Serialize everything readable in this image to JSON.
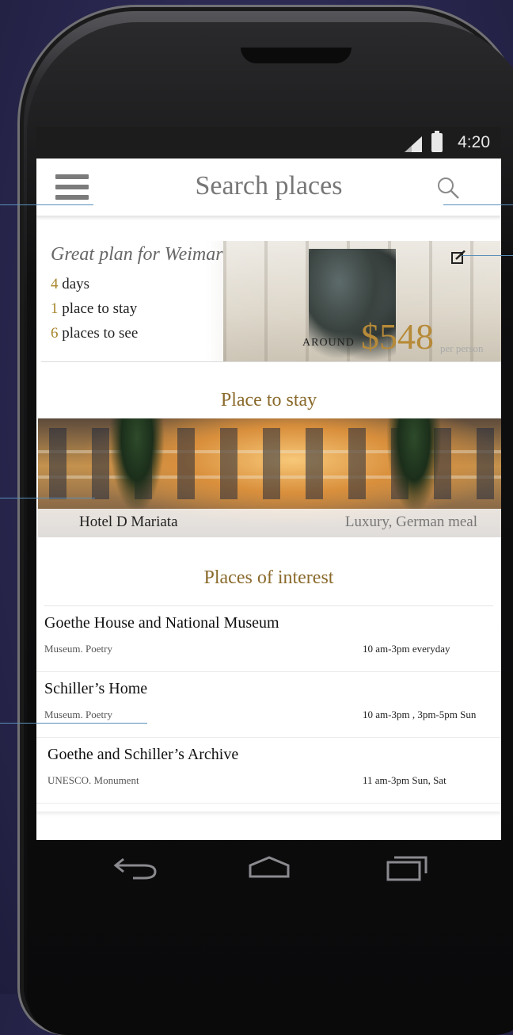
{
  "status_bar": {
    "time": "4:20"
  },
  "app_bar": {
    "title": "Search places"
  },
  "plan": {
    "heading": "Great plan for Weimar",
    "days_num": "4",
    "days_label": "days",
    "stay_num": "1",
    "stay_label": "place to stay",
    "see_num": "6",
    "see_label": "places to see",
    "around": "AROUND",
    "price": "$548",
    "per": "per person"
  },
  "stay_section": {
    "title": "Place to stay",
    "hotel_name": "Hotel D Mariata",
    "hotel_tags": "Luxury, German meal"
  },
  "interest_section": {
    "title": "Places of interest",
    "items": [
      {
        "name": "Goethe House and National Museum",
        "category": "Museum. Poetry",
        "hours": "10 am-3pm everyday"
      },
      {
        "name": "Schiller’s Home",
        "category": "Museum. Poetry",
        "hours": "10 am-3pm , 3pm-5pm Sun"
      },
      {
        "name": "Goethe and Schiller’s Archive",
        "category": "UNESCO. Monument",
        "hours": "11 am-3pm Sun, Sat"
      }
    ]
  },
  "icons": {
    "menu": "menu-icon",
    "search": "search-icon",
    "edit": "edit-icon",
    "back": "back-icon",
    "home": "home-icon",
    "recents": "recents-icon",
    "signal": "signal-icon",
    "battery": "battery-icon"
  },
  "colors": {
    "accent_gold": "#b68a38",
    "callout_line": "#5a8fb8",
    "background": "#2a2850"
  }
}
